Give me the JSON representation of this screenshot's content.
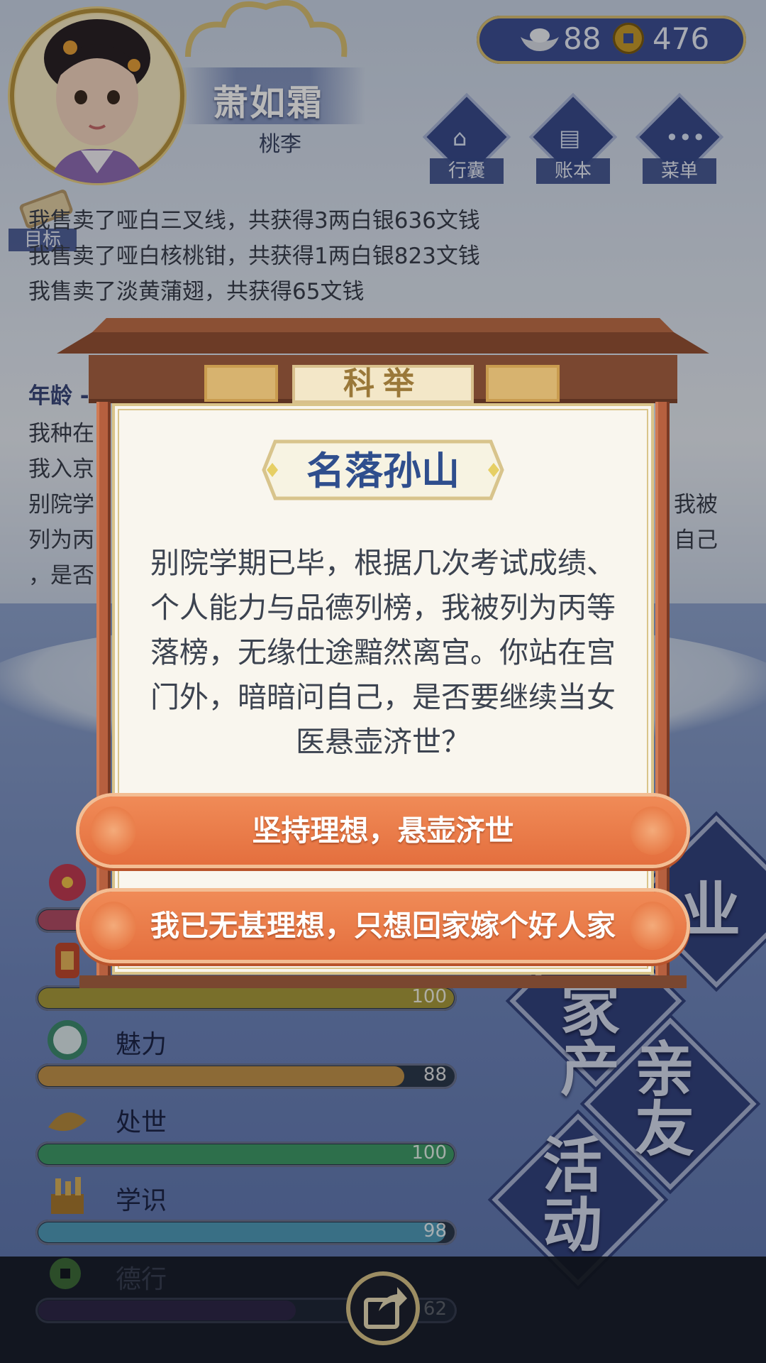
{
  "header": {
    "name": "萧如霜",
    "title": "桃李",
    "currency": {
      "silver": "88",
      "copper": "476"
    },
    "menu": [
      {
        "label": "行囊",
        "icon": "bag-icon"
      },
      {
        "label": "账本",
        "icon": "ledger-icon"
      },
      {
        "label": "菜单",
        "icon": "more-icon"
      }
    ],
    "goal_label": "目标"
  },
  "log": [
    "我售卖了哑白三叉线，共获得3两白银636文钱",
    "我售卖了哑白核桃钳，共获得1两白银823文钱",
    "我售卖了淡黄蒲翅，共获得65文钱"
  ],
  "background_text": {
    "age_heading": "年龄 -",
    "lines_left": [
      "我种在",
      "我入京",
      "别院学",
      "列为丙",
      "，是否"
    ],
    "lines_right": [
      "我被",
      "自己"
    ]
  },
  "stats": [
    {
      "label": "",
      "value": ""
    },
    {
      "label": "",
      "value": "100"
    },
    {
      "label": "魅力",
      "value": "88"
    },
    {
      "label": "处世",
      "value": "100"
    },
    {
      "label": "学识",
      "value": "98"
    },
    {
      "label": "德行",
      "value": "62"
    }
  ],
  "stat_fill": [
    0.3,
    1.0,
    0.88,
    1.0,
    0.98,
    0.62
  ],
  "stat_colors": [
    "#b24d66",
    "#a89a3c",
    "#c2944b",
    "#3f9a68",
    "#4f9ab9",
    "#5a3a7a"
  ],
  "side_buttons": {
    "career_partial": "业",
    "career_partial_left": "",
    "estate": "家产",
    "friends": "亲友",
    "activity": "活动"
  },
  "modal": {
    "category": "科举",
    "result": "名落孙山",
    "story": "别院学期已毕，根据几次考试成绩、个人能力与品德列榜，我被列为丙等落榜，无缘仕途黯然离宫。你站在宫门外，暗暗问自己，是否要继续当女医悬壶济世？",
    "choices": [
      "坚持理想，悬壶济世",
      "我已无甚理想，只想回家嫁个好人家"
    ]
  }
}
